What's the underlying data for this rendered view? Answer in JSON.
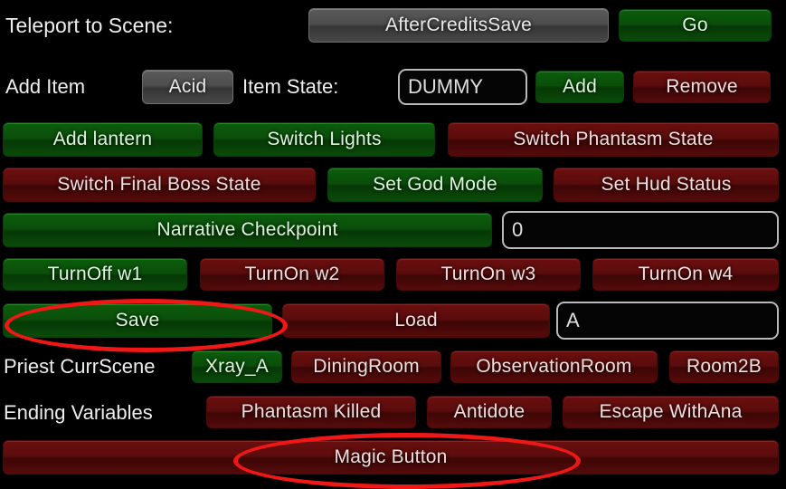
{
  "rows": {
    "teleport": {
      "label": "Teleport to Scene:",
      "scene_dropdown": "AfterCreditsSave",
      "go_label": "Go"
    },
    "item": {
      "add_item_label": "Add Item",
      "item_dropdown": "Acid",
      "item_state_label": "Item State:",
      "item_state_value": "DUMMY",
      "add_label": "Add",
      "remove_label": "Remove"
    },
    "toggles_a": {
      "add_lantern": "Add lantern",
      "switch_lights": "Switch Lights",
      "switch_phantasm_state": "Switch Phantasm State"
    },
    "toggles_b": {
      "switch_final_boss_state": "Switch Final Boss State",
      "set_god_mode": "Set God Mode",
      "set_hud_status": "Set Hud Status"
    },
    "checkpoint": {
      "narrative_checkpoint": "Narrative Checkpoint",
      "value": "0"
    },
    "waypoints": {
      "w1": "TurnOff w1",
      "w2": "TurnOn w2",
      "w3": "TurnOn w3",
      "w4": "TurnOn w4"
    },
    "saveload": {
      "save": "Save",
      "load": "Load",
      "slot_value": "A"
    },
    "priest": {
      "label": "Priest CurrScene",
      "xray_a": "Xray_A",
      "dining_room": "DiningRoom",
      "observation_room": "ObservationRoom",
      "room2b": "Room2B"
    },
    "ending": {
      "label": "Ending Variables",
      "phantasm_killed": "Phantasm Killed",
      "antidote": "Antidote",
      "escape_with_ana": "Escape WithAna"
    },
    "magic": {
      "magic_button": "Magic Button"
    }
  },
  "colors": {
    "green": "#0a4f0a",
    "red": "#5b0c0c",
    "grey": "#4d4d4d",
    "annotation": "#f01717",
    "background": "#000000"
  }
}
